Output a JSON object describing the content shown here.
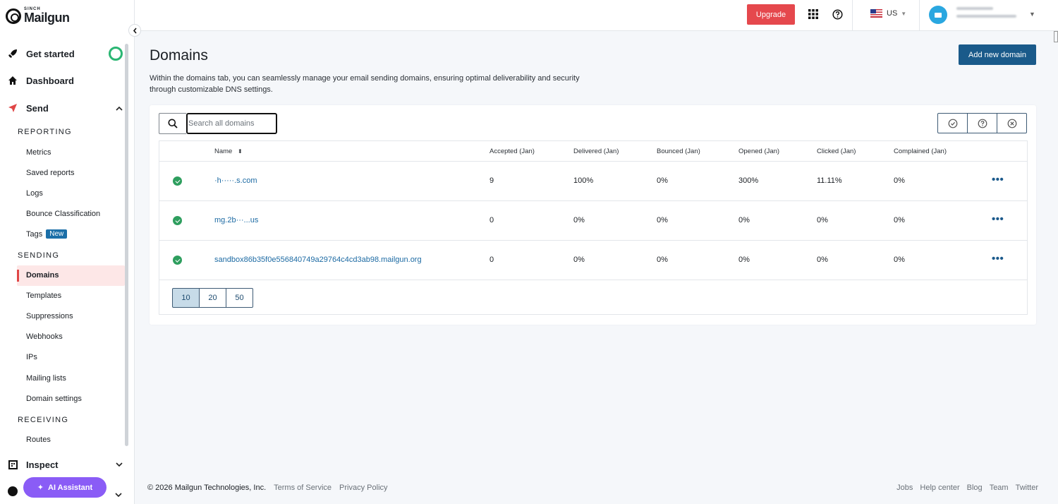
{
  "brand": {
    "sinch": "SINCH",
    "name": "Mailgun"
  },
  "sidebar": {
    "main": [
      {
        "label": "Get started",
        "icon": "rocket-icon"
      },
      {
        "label": "Dashboard",
        "icon": "home-icon"
      },
      {
        "label": "Send",
        "icon": "send-icon",
        "expanded": true
      },
      {
        "label": "Inspect",
        "icon": "inspect-icon"
      }
    ],
    "sections": {
      "reporting": "REPORTING",
      "sending": "SENDING",
      "receiving": "RECEIVING"
    },
    "reporting_items": [
      "Metrics",
      "Saved reports",
      "Logs",
      "Bounce Classification",
      "Tags"
    ],
    "tags_badge": "New",
    "sending_items": [
      "Domains",
      "Templates",
      "Suppressions",
      "Webhooks",
      "IPs",
      "Mailing lists",
      "Domain settings"
    ],
    "receiving_items": [
      "Routes"
    ],
    "active": "Domains",
    "ai_assistant": "AI Assistant"
  },
  "topbar": {
    "upgrade": "Upgrade",
    "region": "US"
  },
  "page": {
    "title": "Domains",
    "description": "Within the domains tab, you can seamlessly manage your email sending domains, ensuring optimal deliverability and security through customizable DNS settings.",
    "add_button": "Add new domain",
    "search_placeholder": "Search all domains"
  },
  "table": {
    "columns": [
      "Name",
      "Accepted (Jan)",
      "Delivered (Jan)",
      "Bounced (Jan)",
      "Opened (Jan)",
      "Clicked (Jan)",
      "Complained (Jan)"
    ],
    "rows": [
      {
        "name": "·h·····.s.com",
        "accepted": "9",
        "delivered": "100%",
        "bounced": "0%",
        "opened": "300%",
        "clicked": "11.11%",
        "complained": "0%"
      },
      {
        "name": "mg.2b···...us",
        "accepted": "0",
        "delivered": "0%",
        "bounced": "0%",
        "opened": "0%",
        "clicked": "0%",
        "complained": "0%"
      },
      {
        "name": "sandbox86b35f0e556840749a29764c4cd3ab98.mailgun.org",
        "accepted": "0",
        "delivered": "0%",
        "bounced": "0%",
        "opened": "0%",
        "clicked": "0%",
        "complained": "0%"
      }
    ],
    "page_sizes": [
      "10",
      "20",
      "50"
    ],
    "selected_page_size": "10"
  },
  "footer": {
    "copyright": "© 2026 Mailgun Technologies, Inc.",
    "left_links": [
      "Terms of Service",
      "Privacy Policy"
    ],
    "right_links": [
      "Jobs",
      "Help center",
      "Blog",
      "Team",
      "Twitter"
    ]
  },
  "colors": {
    "upgrade": "#e5484d",
    "primary": "#1a5a8a",
    "link": "#1c6aa3",
    "success": "#2e9e5e",
    "ai": "#8a5cf6"
  }
}
